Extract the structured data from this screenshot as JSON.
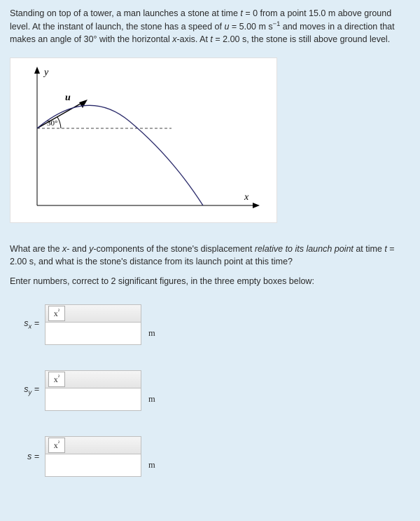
{
  "problem": {
    "text_html": "Standing on top of a tower, a man launches a stone at time <span class='italic'>t</span> = 0 from a point 15.0 m above ground level. At the instant of launch, the stone has a speed of <span class='italic'>u</span> = 5.00 m s<span class='sup'>−1</span> and moves in a direction that makes an angle of 30° with the horizontal <span class='italic'>x</span>-axis. At <span class='italic'>t</span> = 2.00 s, the stone is still above ground level."
  },
  "diagram": {
    "y_label": "y",
    "x_label": "x",
    "u_label": "u",
    "angle_label": "30°"
  },
  "question": {
    "text_html": "What are the <span class='italic'>x</span>- and <span class='italic'>y</span>-components of the stone's displacement <span class='italic'>relative to its launch point</span> at time <span class='italic'>t</span> = 2.00 s, and what is the stone's distance from its launch point at this time?"
  },
  "instruction": "Enter numbers, correct to 2 significant figures, in the three empty boxes below:",
  "answers": {
    "sx": {
      "label_html": "<span class='italic'>s<span class='sub'>x</span></span> =",
      "unit": "m",
      "value": "",
      "tool": "x²"
    },
    "sy": {
      "label_html": "<span class='italic'>s<span class='sub'>y</span></span> =",
      "unit": "m",
      "value": "",
      "tool": "x²"
    },
    "s": {
      "label_html": "<span class='italic'>s</span> =",
      "unit": "m",
      "value": "",
      "tool": "x²"
    }
  }
}
